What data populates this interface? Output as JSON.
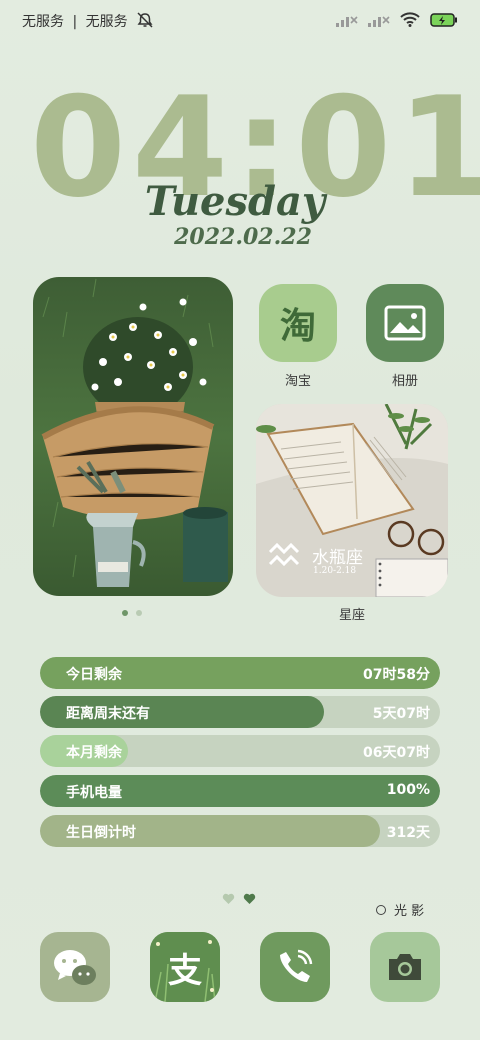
{
  "status_bar": {
    "carrier_1": "无服务",
    "separator": "|",
    "carrier_2": "无服务",
    "icons": [
      "mute-bell-icon",
      "signal-off-icon",
      "signal-off-icon",
      "wifi-icon",
      "battery-charging-icon"
    ]
  },
  "clock": {
    "time": "04:01",
    "weekday": "Tuesday",
    "date": "2022.02.22"
  },
  "photo_widget": {
    "page_count": 2,
    "active_page": 1
  },
  "apps": [
    {
      "label": "淘宝",
      "glyph": "淘",
      "color": "#a8cc8e"
    },
    {
      "label": "相册",
      "color": "#5f8a5a"
    }
  ],
  "zodiac": {
    "name": "水瓶座",
    "range": "1.20-2.18",
    "label": "星座"
  },
  "countdowns": [
    {
      "label": "今日剩余",
      "value": "07时58分",
      "fraction": 1.0,
      "color": "#76a15e"
    },
    {
      "label": "距离周末还有",
      "value": "5天07时",
      "fraction": 0.71,
      "color": "#5a8553"
    },
    {
      "label": "本月剩余",
      "value": "06天07时",
      "fraction": 0.22,
      "color": "#a9d29b"
    },
    {
      "label": "手机电量",
      "value": "100%",
      "fraction": 1.0,
      "color": "#5c8c58"
    },
    {
      "label": "生日倒计时",
      "value": "312天",
      "fraction": 0.85,
      "color": "#a2b489"
    }
  ],
  "light_shadow": {
    "label": "光 影"
  },
  "home_pages": {
    "count": 2,
    "active": 2
  },
  "dock": [
    {
      "name": "wechat",
      "color": "#a6b591"
    },
    {
      "name": "alipay",
      "color": "#6b9a5e",
      "glyph": "支"
    },
    {
      "name": "phone",
      "color": "#6f9a5e"
    },
    {
      "name": "camera",
      "color": "#a6c89a"
    }
  ]
}
